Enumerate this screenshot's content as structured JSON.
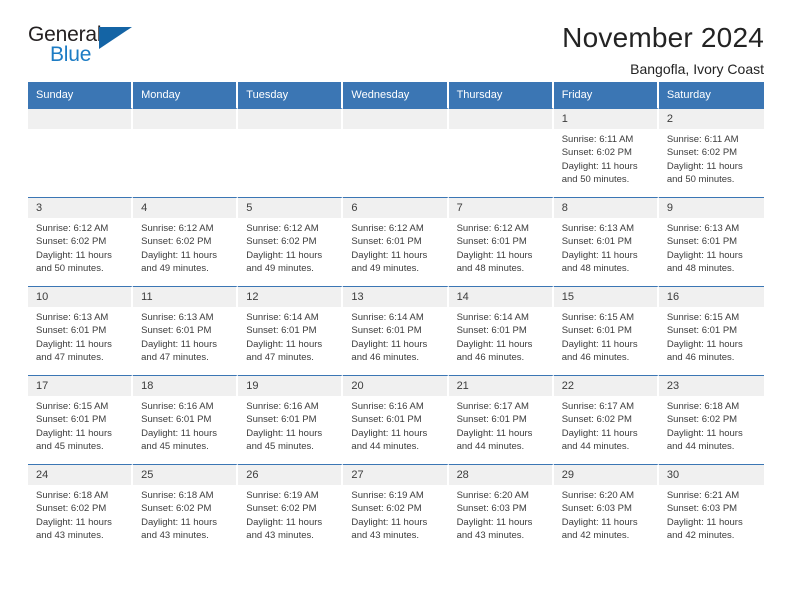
{
  "brand": {
    "name_top": "General",
    "name_bottom": "Blue",
    "triangle_color": "#1464a5",
    "blue_color": "#1d7cc4"
  },
  "header": {
    "title": "November 2024",
    "subtitle": "Bangofla, Ivory Coast"
  },
  "theme": {
    "header_blue": "#3b76b4",
    "daynum_gray": "#f0f0f0",
    "text": "#3c3c3c"
  },
  "weekday_headers": [
    "Sunday",
    "Monday",
    "Tuesday",
    "Wednesday",
    "Thursday",
    "Friday",
    "Saturday"
  ],
  "labels": {
    "sunrise_prefix": "Sunrise:",
    "sunset_prefix": "Sunset:",
    "daylight_prefix": "Daylight:"
  },
  "weeks": [
    [
      {
        "day": "",
        "empty": true
      },
      {
        "day": "",
        "empty": true
      },
      {
        "day": "",
        "empty": true
      },
      {
        "day": "",
        "empty": true
      },
      {
        "day": "",
        "empty": true
      },
      {
        "day": "1",
        "sunrise": "Sunrise: 6:11 AM",
        "sunset": "Sunset: 6:02 PM",
        "daylight": "Daylight: 11 hours and 50 minutes."
      },
      {
        "day": "2",
        "sunrise": "Sunrise: 6:11 AM",
        "sunset": "Sunset: 6:02 PM",
        "daylight": "Daylight: 11 hours and 50 minutes."
      }
    ],
    [
      {
        "day": "3",
        "sunrise": "Sunrise: 6:12 AM",
        "sunset": "Sunset: 6:02 PM",
        "daylight": "Daylight: 11 hours and 50 minutes."
      },
      {
        "day": "4",
        "sunrise": "Sunrise: 6:12 AM",
        "sunset": "Sunset: 6:02 PM",
        "daylight": "Daylight: 11 hours and 49 minutes."
      },
      {
        "day": "5",
        "sunrise": "Sunrise: 6:12 AM",
        "sunset": "Sunset: 6:02 PM",
        "daylight": "Daylight: 11 hours and 49 minutes."
      },
      {
        "day": "6",
        "sunrise": "Sunrise: 6:12 AM",
        "sunset": "Sunset: 6:01 PM",
        "daylight": "Daylight: 11 hours and 49 minutes."
      },
      {
        "day": "7",
        "sunrise": "Sunrise: 6:12 AM",
        "sunset": "Sunset: 6:01 PM",
        "daylight": "Daylight: 11 hours and 48 minutes."
      },
      {
        "day": "8",
        "sunrise": "Sunrise: 6:13 AM",
        "sunset": "Sunset: 6:01 PM",
        "daylight": "Daylight: 11 hours and 48 minutes."
      },
      {
        "day": "9",
        "sunrise": "Sunrise: 6:13 AM",
        "sunset": "Sunset: 6:01 PM",
        "daylight": "Daylight: 11 hours and 48 minutes."
      }
    ],
    [
      {
        "day": "10",
        "sunrise": "Sunrise: 6:13 AM",
        "sunset": "Sunset: 6:01 PM",
        "daylight": "Daylight: 11 hours and 47 minutes."
      },
      {
        "day": "11",
        "sunrise": "Sunrise: 6:13 AM",
        "sunset": "Sunset: 6:01 PM",
        "daylight": "Daylight: 11 hours and 47 minutes."
      },
      {
        "day": "12",
        "sunrise": "Sunrise: 6:14 AM",
        "sunset": "Sunset: 6:01 PM",
        "daylight": "Daylight: 11 hours and 47 minutes."
      },
      {
        "day": "13",
        "sunrise": "Sunrise: 6:14 AM",
        "sunset": "Sunset: 6:01 PM",
        "daylight": "Daylight: 11 hours and 46 minutes."
      },
      {
        "day": "14",
        "sunrise": "Sunrise: 6:14 AM",
        "sunset": "Sunset: 6:01 PM",
        "daylight": "Daylight: 11 hours and 46 minutes."
      },
      {
        "day": "15",
        "sunrise": "Sunrise: 6:15 AM",
        "sunset": "Sunset: 6:01 PM",
        "daylight": "Daylight: 11 hours and 46 minutes."
      },
      {
        "day": "16",
        "sunrise": "Sunrise: 6:15 AM",
        "sunset": "Sunset: 6:01 PM",
        "daylight": "Daylight: 11 hours and 46 minutes."
      }
    ],
    [
      {
        "day": "17",
        "sunrise": "Sunrise: 6:15 AM",
        "sunset": "Sunset: 6:01 PM",
        "daylight": "Daylight: 11 hours and 45 minutes."
      },
      {
        "day": "18",
        "sunrise": "Sunrise: 6:16 AM",
        "sunset": "Sunset: 6:01 PM",
        "daylight": "Daylight: 11 hours and 45 minutes."
      },
      {
        "day": "19",
        "sunrise": "Sunrise: 6:16 AM",
        "sunset": "Sunset: 6:01 PM",
        "daylight": "Daylight: 11 hours and 45 minutes."
      },
      {
        "day": "20",
        "sunrise": "Sunrise: 6:16 AM",
        "sunset": "Sunset: 6:01 PM",
        "daylight": "Daylight: 11 hours and 44 minutes."
      },
      {
        "day": "21",
        "sunrise": "Sunrise: 6:17 AM",
        "sunset": "Sunset: 6:01 PM",
        "daylight": "Daylight: 11 hours and 44 minutes."
      },
      {
        "day": "22",
        "sunrise": "Sunrise: 6:17 AM",
        "sunset": "Sunset: 6:02 PM",
        "daylight": "Daylight: 11 hours and 44 minutes."
      },
      {
        "day": "23",
        "sunrise": "Sunrise: 6:18 AM",
        "sunset": "Sunset: 6:02 PM",
        "daylight": "Daylight: 11 hours and 44 minutes."
      }
    ],
    [
      {
        "day": "24",
        "sunrise": "Sunrise: 6:18 AM",
        "sunset": "Sunset: 6:02 PM",
        "daylight": "Daylight: 11 hours and 43 minutes."
      },
      {
        "day": "25",
        "sunrise": "Sunrise: 6:18 AM",
        "sunset": "Sunset: 6:02 PM",
        "daylight": "Daylight: 11 hours and 43 minutes."
      },
      {
        "day": "26",
        "sunrise": "Sunrise: 6:19 AM",
        "sunset": "Sunset: 6:02 PM",
        "daylight": "Daylight: 11 hours and 43 minutes."
      },
      {
        "day": "27",
        "sunrise": "Sunrise: 6:19 AM",
        "sunset": "Sunset: 6:02 PM",
        "daylight": "Daylight: 11 hours and 43 minutes."
      },
      {
        "day": "28",
        "sunrise": "Sunrise: 6:20 AM",
        "sunset": "Sunset: 6:03 PM",
        "daylight": "Daylight: 11 hours and 43 minutes."
      },
      {
        "day": "29",
        "sunrise": "Sunrise: 6:20 AM",
        "sunset": "Sunset: 6:03 PM",
        "daylight": "Daylight: 11 hours and 42 minutes."
      },
      {
        "day": "30",
        "sunrise": "Sunrise: 6:21 AM",
        "sunset": "Sunset: 6:03 PM",
        "daylight": "Daylight: 11 hours and 42 minutes."
      }
    ]
  ]
}
